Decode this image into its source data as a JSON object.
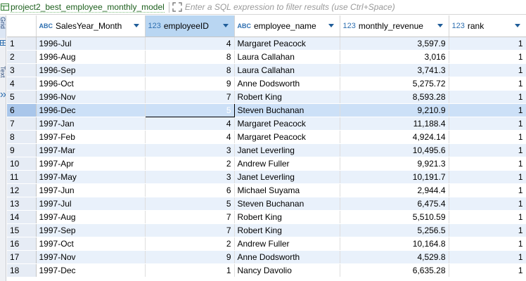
{
  "toolbar": {
    "title": "project2_best_employee_monthly_model",
    "filter_placeholder": "Enter a SQL expression to filter results (use Ctrl+Space)"
  },
  "side_tabs": {
    "grid": "Grid",
    "text": "Text"
  },
  "columns": [
    {
      "label": "",
      "type": ""
    },
    {
      "label": "SalesYear_Month",
      "type": "ABC"
    },
    {
      "label": "employeeID",
      "type": "123"
    },
    {
      "label": "employee_name",
      "type": "ABC"
    },
    {
      "label": "monthly_revenue",
      "type": "123"
    },
    {
      "label": "rank",
      "type": "123"
    }
  ],
  "rows": [
    [
      "1",
      "1996-Jul",
      "4",
      "Margaret Peacock",
      "3,597.9",
      "1"
    ],
    [
      "2",
      "1996-Aug",
      "8",
      "Laura Callahan",
      "3,016",
      "1"
    ],
    [
      "3",
      "1996-Sep",
      "8",
      "Laura Callahan",
      "3,741.3",
      "1"
    ],
    [
      "4",
      "1996-Oct",
      "9",
      "Anne Dodsworth",
      "5,275.72",
      "1"
    ],
    [
      "5",
      "1996-Nov",
      "7",
      "Robert King",
      "8,593.28",
      "1"
    ],
    [
      "6",
      "1996-Dec",
      "5",
      "Steven Buchanan",
      "9,210.9",
      "1"
    ],
    [
      "7",
      "1997-Jan",
      "4",
      "Margaret Peacock",
      "11,188.4",
      "1"
    ],
    [
      "8",
      "1997-Feb",
      "4",
      "Margaret Peacock",
      "4,924.14",
      "1"
    ],
    [
      "9",
      "1997-Mar",
      "3",
      "Janet Leverling",
      "10,495.6",
      "1"
    ],
    [
      "10",
      "1997-Apr",
      "2",
      "Andrew Fuller",
      "9,921.3",
      "1"
    ],
    [
      "11",
      "1997-May",
      "3",
      "Janet Leverling",
      "10,191.7",
      "1"
    ],
    [
      "12",
      "1997-Jun",
      "6",
      "Michael Suyama",
      "2,944.4",
      "1"
    ],
    [
      "13",
      "1997-Jul",
      "5",
      "Steven Buchanan",
      "6,475.4",
      "1"
    ],
    [
      "14",
      "1997-Aug",
      "7",
      "Robert King",
      "5,510.59",
      "1"
    ],
    [
      "15",
      "1997-Sep",
      "7",
      "Robert King",
      "5,256.5",
      "1"
    ],
    [
      "16",
      "1997-Oct",
      "2",
      "Andrew Fuller",
      "10,164.8",
      "1"
    ],
    [
      "17",
      "1997-Nov",
      "9",
      "Anne Dodsworth",
      "4,529.8",
      "1"
    ],
    [
      "18",
      "1997-Dec",
      "1",
      "Nancy Davolio",
      "6,635.28",
      "1"
    ]
  ],
  "selected_row": 6,
  "sorted_column": "employeeID"
}
